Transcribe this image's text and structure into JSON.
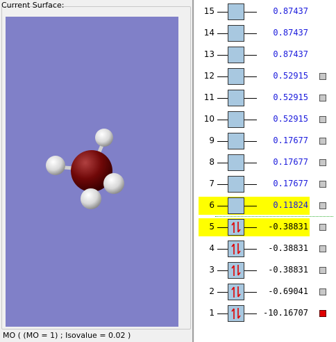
{
  "surface": {
    "title": "Current Surface:",
    "status": "MO ( (MO = 1) ; Isovalue = 0.02 )"
  },
  "colors": {
    "viewport": "#8080c8",
    "highlight": "#ffff00",
    "orbital_box": "#a8c8e0",
    "selected_square": "#e00000"
  },
  "orbitals": [
    {
      "index": "15",
      "energy": "0.87437",
      "occupied": false,
      "highlight": false,
      "selector": "none"
    },
    {
      "index": "14",
      "energy": "0.87437",
      "occupied": false,
      "highlight": false,
      "selector": "none"
    },
    {
      "index": "13",
      "energy": "0.87437",
      "occupied": false,
      "highlight": false,
      "selector": "none"
    },
    {
      "index": "12",
      "energy": "0.52915",
      "occupied": false,
      "highlight": false,
      "selector": "gray"
    },
    {
      "index": "11",
      "energy": "0.52915",
      "occupied": false,
      "highlight": false,
      "selector": "gray"
    },
    {
      "index": "10",
      "energy": "0.52915",
      "occupied": false,
      "highlight": false,
      "selector": "gray"
    },
    {
      "index": "9",
      "energy": "0.17677",
      "occupied": false,
      "highlight": false,
      "selector": "gray"
    },
    {
      "index": "8",
      "energy": "0.17677",
      "occupied": false,
      "highlight": false,
      "selector": "gray"
    },
    {
      "index": "7",
      "energy": "0.17677",
      "occupied": false,
      "highlight": false,
      "selector": "gray"
    },
    {
      "index": "6",
      "energy": "0.11824",
      "occupied": false,
      "highlight": true,
      "selector": "gray"
    },
    {
      "index": "5",
      "energy": "-0.38831",
      "occupied": true,
      "highlight": true,
      "selector": "gray"
    },
    {
      "index": "4",
      "energy": "-0.38831",
      "occupied": true,
      "highlight": false,
      "selector": "gray"
    },
    {
      "index": "3",
      "energy": "-0.38831",
      "occupied": true,
      "highlight": false,
      "selector": "gray"
    },
    {
      "index": "2",
      "energy": "-0.69041",
      "occupied": true,
      "highlight": false,
      "selector": "gray"
    },
    {
      "index": "1",
      "energy": "-10.16707",
      "occupied": true,
      "highlight": false,
      "selector": "red"
    }
  ]
}
